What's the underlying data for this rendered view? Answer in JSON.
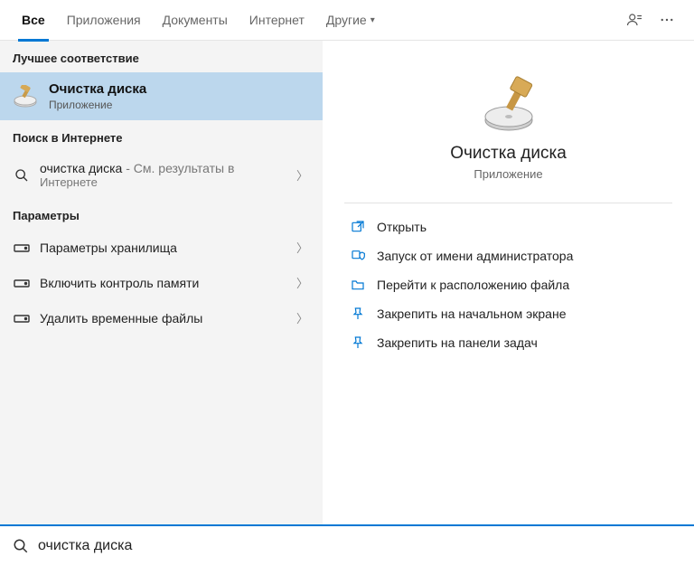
{
  "tabs": {
    "all": "Все",
    "apps": "Приложения",
    "docs": "Документы",
    "web": "Интернет",
    "other": "Другие"
  },
  "sections": {
    "best": "Лучшее соответствие",
    "web": "Поиск в Интернете",
    "settings": "Параметры"
  },
  "best": {
    "title": "Очистка диска",
    "subtitle": "Приложение"
  },
  "webrow": {
    "query": "очистка диска",
    "suffix": " - См. результаты в",
    "line2": "Интернете"
  },
  "settingsRows": [
    {
      "label": "Параметры хранилища"
    },
    {
      "label": "Включить контроль памяти"
    },
    {
      "label": "Удалить временные файлы"
    }
  ],
  "preview": {
    "title": "Очистка диска",
    "subtitle": "Приложение"
  },
  "actions": [
    {
      "label": "Открыть"
    },
    {
      "label": "Запуск от имени администратора"
    },
    {
      "label": "Перейти к расположению файла"
    },
    {
      "label": "Закрепить на начальном экране"
    },
    {
      "label": "Закрепить на панели задач"
    }
  ],
  "search": {
    "value": "очистка диска"
  },
  "colors": {
    "accent": "#0078d4",
    "selection": "#bcd7ed"
  }
}
